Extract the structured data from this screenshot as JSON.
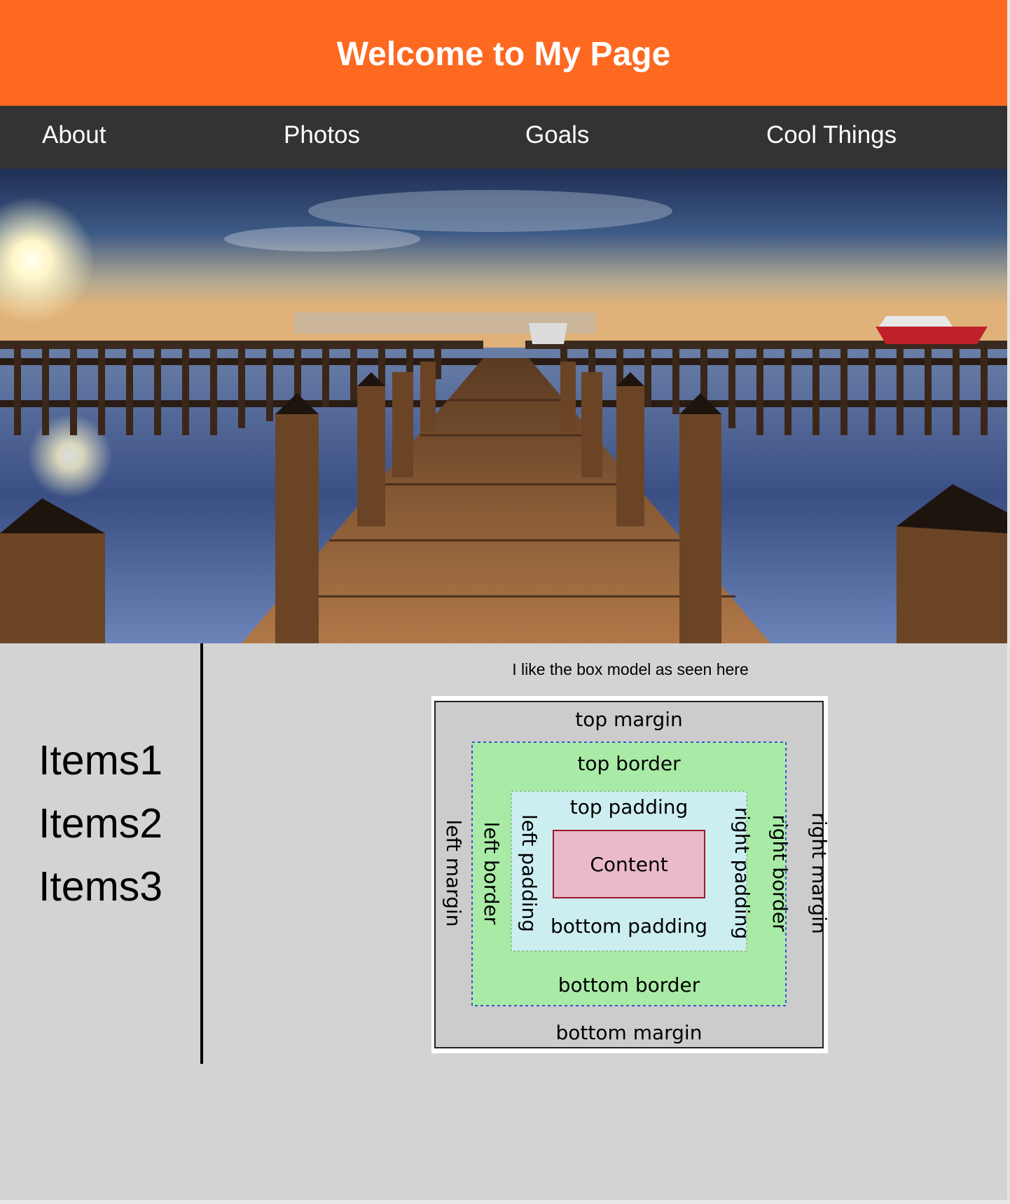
{
  "header": {
    "title": "Welcome to My Page"
  },
  "nav": {
    "items": [
      {
        "label": "About"
      },
      {
        "label": "Photos"
      },
      {
        "label": "Goals"
      },
      {
        "label": "Cool Things"
      }
    ]
  },
  "hero": {
    "image": "pier-sunset-photo"
  },
  "sidebar": {
    "items": [
      {
        "label": "Items1"
      },
      {
        "label": "Items2"
      },
      {
        "label": "Items3"
      }
    ]
  },
  "main": {
    "caption": "I like the box model as seen here",
    "box_model": {
      "top_margin": "top margin",
      "bottom_margin": "bottom margin",
      "left_margin": "left margin",
      "right_margin": "right margin",
      "top_border": "top border",
      "bottom_border": "bottom border",
      "left_border": "left border",
      "right_border": "right border",
      "top_padding": "top padding",
      "bottom_padding": "bottom padding",
      "left_padding": "left padding",
      "right_padding": "right padding",
      "content": "Content"
    }
  },
  "colors": {
    "header": "#fd6921",
    "nav": "#333333",
    "page": "#d3d3d3",
    "margin": "#cccccc",
    "border": "#a9eba6",
    "padding": "#cdeef0",
    "content": "#ebbaca"
  }
}
